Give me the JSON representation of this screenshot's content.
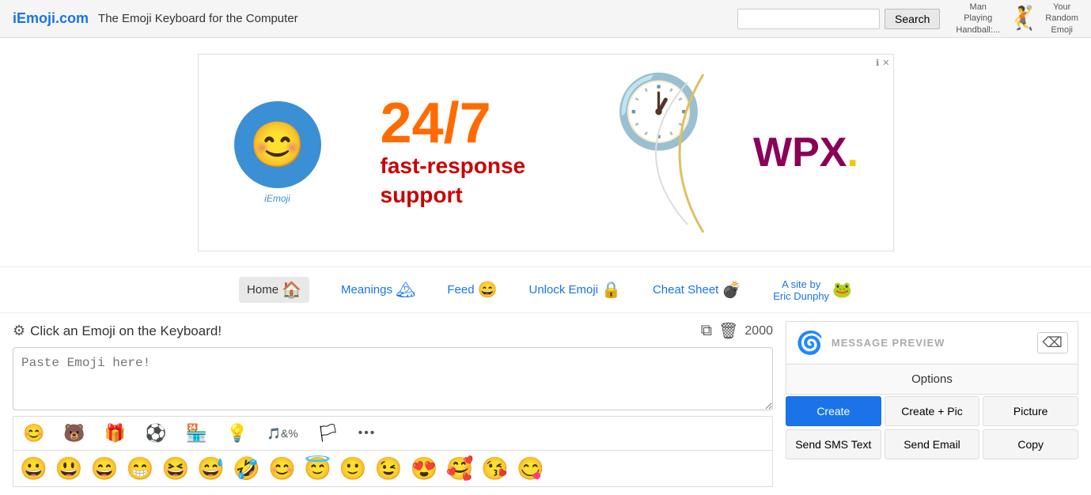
{
  "header": {
    "logo": "iEmoji.com",
    "tagline": "The Emoji Keyboard for the Computer",
    "search_placeholder": "",
    "search_btn": "Search",
    "right_text1": "Man\nPlaying\nHandball:...",
    "right_text2": "Your\nRandom\nEmoji"
  },
  "nav": {
    "items": [
      {
        "label": "Home",
        "emoji": "🏠",
        "active": true
      },
      {
        "label": "Meanings",
        "emoji": "🏔",
        "active": false
      },
      {
        "label": "Feed",
        "emoji": "😄",
        "active": false
      },
      {
        "label": "Unlock Emoji",
        "emoji": "🔒",
        "active": false
      },
      {
        "label": "Cheat Sheet",
        "emoji": "💣",
        "active": false
      },
      {
        "label": "A site by\nEric Dunphy",
        "emoji": "🐸",
        "active": false
      }
    ]
  },
  "keyboard": {
    "instruction": "Click an Emoji on the Keyboard!",
    "textarea_placeholder": "Paste Emoji here!",
    "char_count": "2000",
    "emoji_tabs": [
      "😊",
      "🐻",
      "🎁",
      "⚽",
      "🏪",
      "💡",
      "🎵&%",
      "🏳",
      "•••"
    ],
    "emoji_rows": [
      [
        "😀",
        "😃",
        "😄",
        "😁",
        "😆",
        "😅",
        "🤣",
        "😊",
        "😇",
        "🙂",
        "😉",
        "😍",
        "🥰",
        "😘",
        "😋"
      ]
    ]
  },
  "preview": {
    "label": "MESSAGE PREVIEW",
    "options_btn": "Options",
    "create_btn": "Create",
    "create_pic_btn": "Create + Pic",
    "picture_btn": "Picture",
    "send_sms_btn": "Send SMS Text",
    "send_email_btn": "Send Email",
    "copy_btn": "Copy"
  },
  "ad": {
    "number": "24/7",
    "subtitle": "fast-response\nsupport",
    "brand": "WPX"
  }
}
